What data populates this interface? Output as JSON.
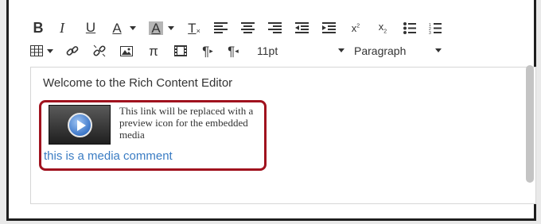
{
  "toolbar": {
    "bold": "B",
    "italic": "I",
    "underline": "U",
    "font_color": "A",
    "bg_color": "A",
    "clear_format": "T",
    "pi": "π",
    "font_size": "11pt",
    "format": "Paragraph"
  },
  "editor": {
    "welcome_text": "Welcome to the Rich Content Editor",
    "media_note": "This link will be replaced with a preview icon for the embedded media",
    "media_link": "this is a media comment"
  },
  "colors": {
    "highlight_border": "#a0121e",
    "link": "#3a7cc3"
  }
}
